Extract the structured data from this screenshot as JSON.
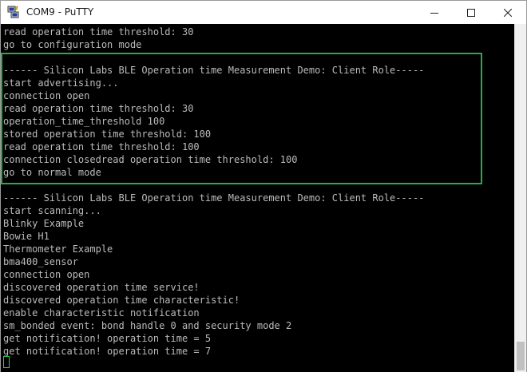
{
  "window": {
    "title": "COM9 - PuTTY",
    "icon": "putty-icon"
  },
  "controls": {
    "minimize_icon": "minimize-icon",
    "maximize_icon": "maximize-icon",
    "close_icon": "close-icon"
  },
  "colors": {
    "terminal_bg": "#000000",
    "terminal_text": "#bbbbbb",
    "highlight_border": "#2da84a",
    "cursor": "#2ecc40"
  },
  "terminal": {
    "lines": [
      "read operation time threshold: 30",
      "go to configuration mode",
      "",
      "------ Silicon Labs BLE Operation time Measurement Demo: Client Role-----",
      "start advertising...",
      "connection open",
      "read operation time threshold: 30",
      "operation_time_threshold 100",
      "stored operation time threshold: 100",
      "read operation time threshold: 100",
      "connection closedread operation time threshold: 100",
      "go to normal mode",
      "",
      "------ Silicon Labs BLE Operation time Measurement Demo: Client Role-----",
      "start scanning...",
      "Blinky Example",
      "Bowie H1",
      "Thermometer Example",
      "bma400_sensor",
      "connection open",
      "discovered operation time service!",
      "discovered operation time characteristic!",
      "enable characteristic notification",
      "sm_bonded event: bond handle 0 and security mode 2",
      "get notification! operation time = 5",
      "get notification! operation time = 7"
    ]
  }
}
